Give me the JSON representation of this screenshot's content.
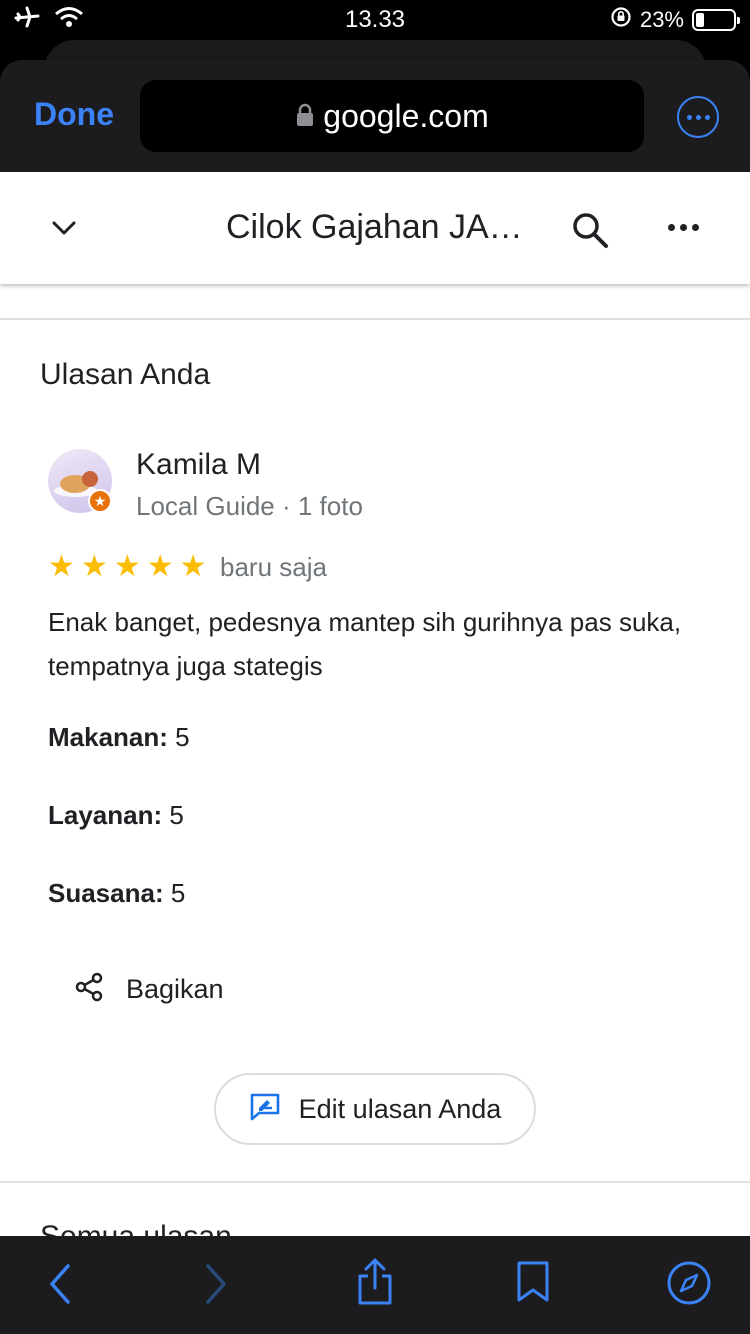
{
  "status_bar": {
    "time": "13.33",
    "battery_percent": "23%",
    "battery_level": 0.23,
    "icons": [
      "airplane-icon",
      "wifi-icon",
      "rotation-lock-icon",
      "battery-icon"
    ]
  },
  "browser": {
    "done_label": "Done",
    "url": "google.com",
    "accent": "#3b82f6"
  },
  "header": {
    "title": "Cilok Gajahan JA…"
  },
  "review_section": {
    "title": "Ulasan Anda",
    "reviewer_name": "Kamila M",
    "reviewer_meta": "Local Guide · 1 foto",
    "rating": 5,
    "time": "baru saja",
    "text": "Enak banget, pedesnya mantep sih gurihnya pas suka, tempatnya juga stategis",
    "attributes": [
      {
        "label": "Makanan:",
        "value": "5"
      },
      {
        "label": "Layanan:",
        "value": "5"
      },
      {
        "label": "Suasana:",
        "value": "5"
      }
    ],
    "share_label": "Bagikan",
    "edit_label": "Edit ulasan Anda"
  },
  "next_section": {
    "title": "Semua ulasan"
  },
  "toolbar": {
    "icons": [
      "back-icon",
      "forward-icon",
      "share-icon",
      "bookmarks-icon",
      "compass-icon"
    ]
  },
  "colors": {
    "star": "#fbbc04",
    "link_blue": "#3b82f6",
    "text_primary": "#202124",
    "text_secondary": "#70757a"
  }
}
